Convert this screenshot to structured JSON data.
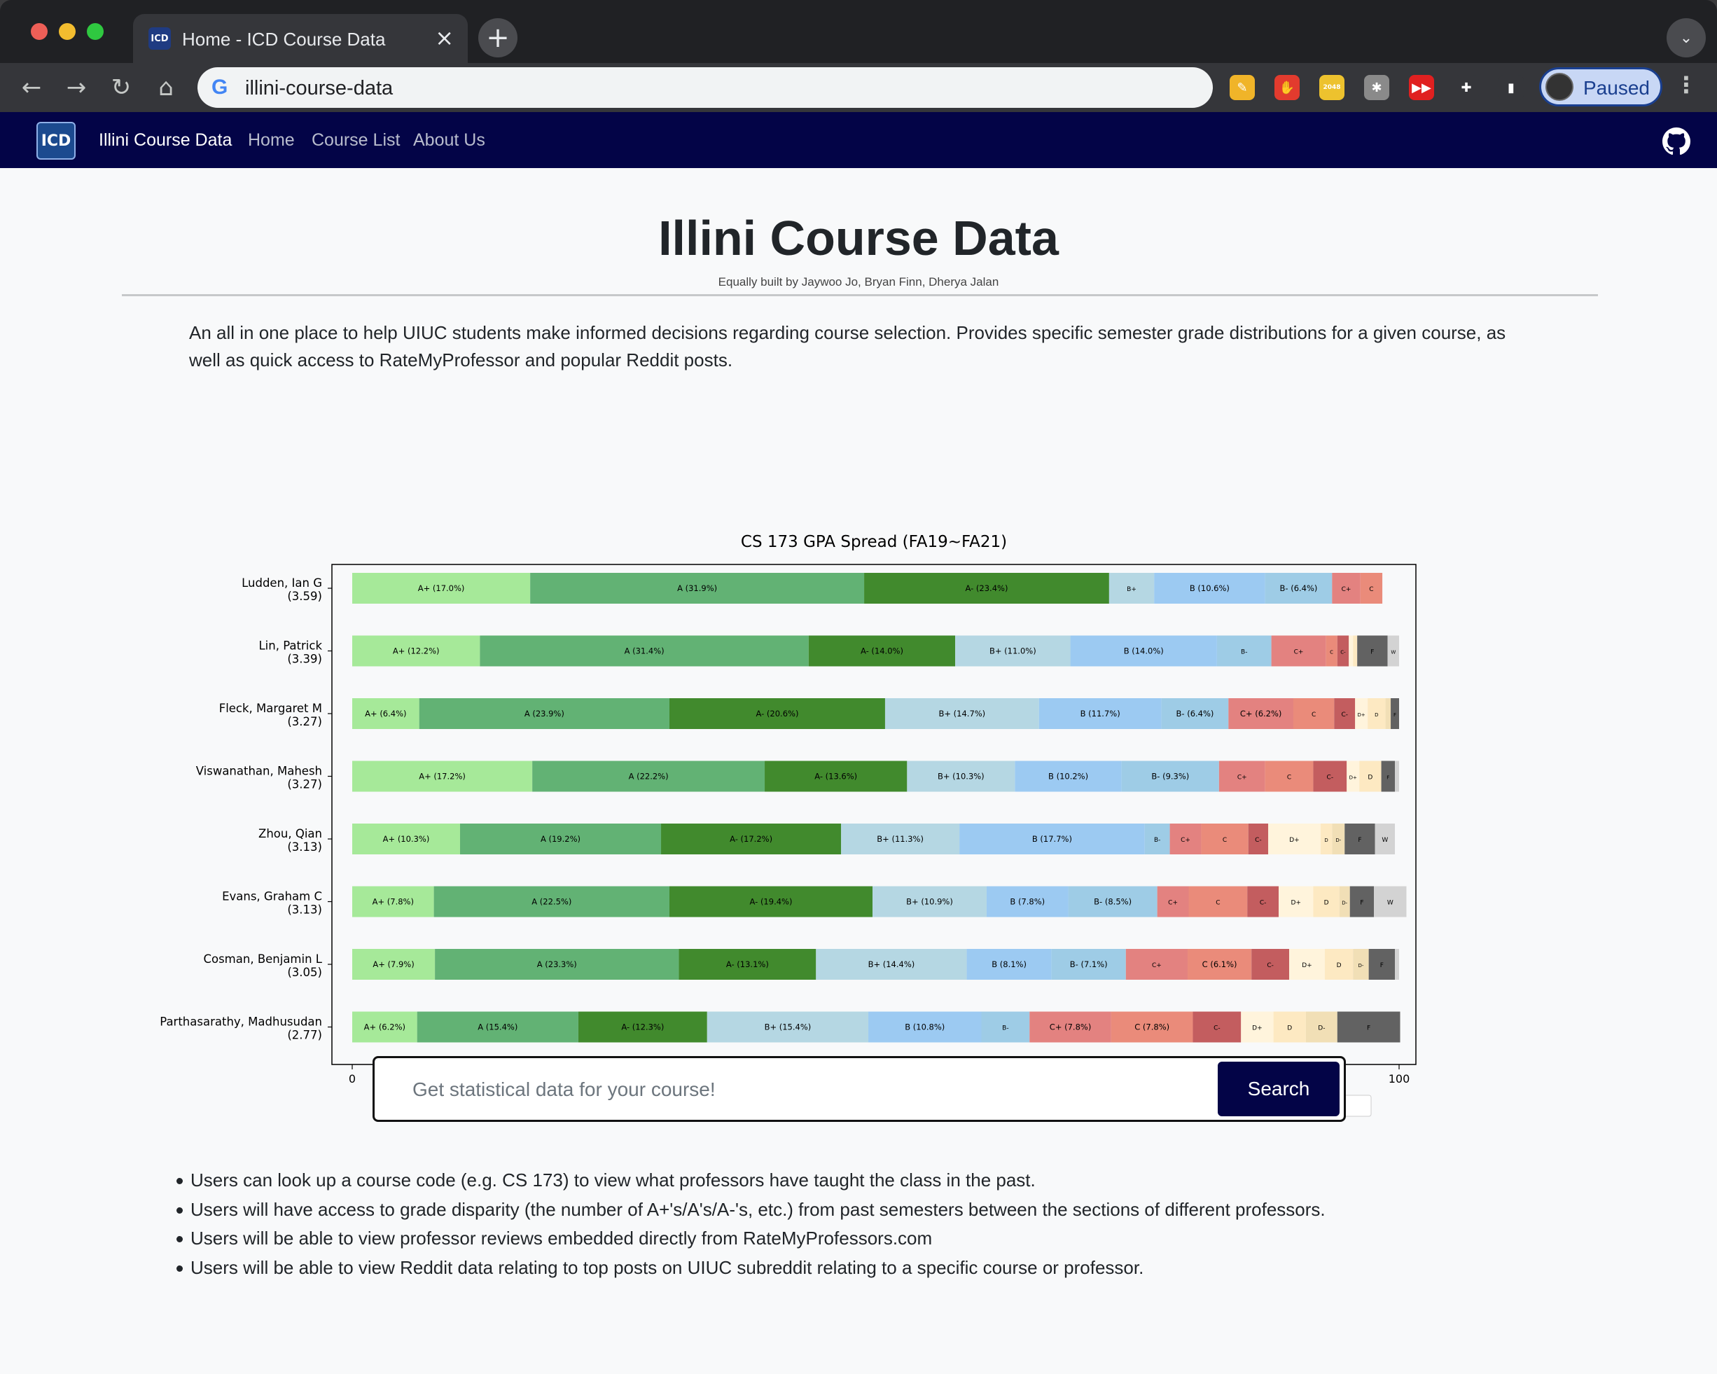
{
  "browser": {
    "tab_title": "Home - ICD Course Data",
    "tab_favicon_text": "ICD",
    "url": "illini-course-data",
    "profile_label": "Paused",
    "extensions": [
      {
        "name": "pencil-extension-icon",
        "color": "#f0b429",
        "glyph": "✎"
      },
      {
        "name": "adblock-extension-icon",
        "color": "#e23b2e",
        "glyph": "✋"
      },
      {
        "name": "2048-extension-icon",
        "color": "#edc22e",
        "glyph": "2048"
      },
      {
        "name": "bug-extension-icon",
        "color": "#8a8a8a",
        "glyph": "✱"
      },
      {
        "name": "video-speed-extension-icon",
        "color": "#e02020",
        "glyph": "▶▶"
      },
      {
        "name": "puzzle-extension-icon",
        "color": "#35363a",
        "glyph": "✚"
      },
      {
        "name": "sidepanel-icon",
        "color": "#35363a",
        "glyph": "▮"
      }
    ]
  },
  "site": {
    "logo_text": "ICD",
    "brand": "Illini Course Data",
    "nav": [
      "Home",
      "Course List",
      "About Us"
    ],
    "title": "Illini Course Data",
    "credit": "Equally built by Jaywoo Jo, Bryan Finn, Dherya Jalan",
    "intro": "An all in one place to help UIUC students make informed decisions regarding course selection. Provides specific semester grade distributions for a given course, as well as quick access to RateMyProfessor and popular Reddit posts."
  },
  "search": {
    "placeholder": "Get statistical data for your course!",
    "button_label": "Search"
  },
  "features": [
    "Users can look up a course code (e.g. CS 173) to view what professors have taught the class in the past.",
    "Users will have access to grade disparity (the number of A+'s/A's/A-'s, etc.) from past semesters between the sections of different professors.",
    "Users will be able to view professor reviews embedded directly from RateMyProfessors.com",
    "Users will be able to view Reddit data relating to top posts on UIUC subreddit relating to a specific course or professor."
  ],
  "chart_data": {
    "type": "bar",
    "orientation": "horizontal-stacked",
    "title": "CS 173 GPA Spread (FA19~FA21)",
    "xlim": [
      0,
      100
    ],
    "xticks": [
      0,
      20,
      40,
      60,
      80,
      100
    ],
    "legend_position": "bottom",
    "grades": [
      "A+",
      "A",
      "A-",
      "B+",
      "B",
      "B-",
      "C+",
      "C",
      "C-",
      "D+",
      "D",
      "D-",
      "F",
      "W"
    ],
    "colors": [
      "#a6e999",
      "#62b274",
      "#418a2d",
      "#b5d7e3",
      "#9ccaf2",
      "#9ecce6",
      "#e38280",
      "#ea8b7a",
      "#c35d5f",
      "#fff4dc",
      "#fde9c2",
      "#f1dfb6",
      "#626262",
      "#d3d3d3"
    ],
    "professors": [
      {
        "name": "Ludden, Ian G",
        "gpa": "(3.59)",
        "values": [
          17.0,
          31.9,
          23.4,
          4.3,
          10.6,
          6.4,
          2.7,
          2.1,
          0,
          0,
          0,
          0,
          0,
          0
        ]
      },
      {
        "name": "Lin, Patrick",
        "gpa": "(3.39)",
        "values": [
          12.2,
          31.4,
          14.0,
          11.0,
          14.0,
          5.2,
          5.2,
          1.1,
          1.1,
          0.4,
          0.4,
          0,
          2.9,
          1.1
        ]
      },
      {
        "name": "Fleck, Margaret M",
        "gpa": "(3.27)",
        "values": [
          6.4,
          23.9,
          20.6,
          14.7,
          11.7,
          6.4,
          6.2,
          3.9,
          2.0,
          1.2,
          1.7,
          0.5,
          0.8,
          0
        ]
      },
      {
        "name": "Viswanathan, Mahesh",
        "gpa": "(3.27)",
        "values": [
          17.2,
          22.2,
          13.6,
          10.3,
          10.2,
          9.3,
          4.4,
          4.6,
          3.2,
          1.2,
          2.1,
          0,
          1.3,
          0.4
        ]
      },
      {
        "name": "Zhou, Qian",
        "gpa": "(3.13)",
        "values": [
          10.3,
          19.2,
          17.2,
          11.3,
          17.7,
          2.4,
          3.0,
          4.5,
          1.9,
          5.0,
          1.1,
          1.2,
          2.9,
          1.9
        ]
      },
      {
        "name": "Evans, Graham C",
        "gpa": "(3.13)",
        "values": [
          7.8,
          22.5,
          19.4,
          10.9,
          7.8,
          8.5,
          3.0,
          5.6,
          3.0,
          3.3,
          2.5,
          1.0,
          2.3,
          3.1
        ]
      },
      {
        "name": "Cosman, Benjamin L",
        "gpa": "(3.05)",
        "values": [
          7.9,
          23.3,
          13.1,
          14.4,
          8.1,
          7.1,
          5.9,
          6.1,
          3.6,
          3.4,
          2.7,
          1.5,
          2.5,
          0.4
        ]
      },
      {
        "name": "Parthasarathy, Madhusudan",
        "gpa": "(2.77)",
        "values": [
          6.2,
          15.4,
          12.3,
          15.4,
          10.8,
          4.6,
          7.8,
          7.8,
          4.6,
          3.1,
          3.1,
          3.0,
          6.0,
          0
        ]
      }
    ]
  }
}
